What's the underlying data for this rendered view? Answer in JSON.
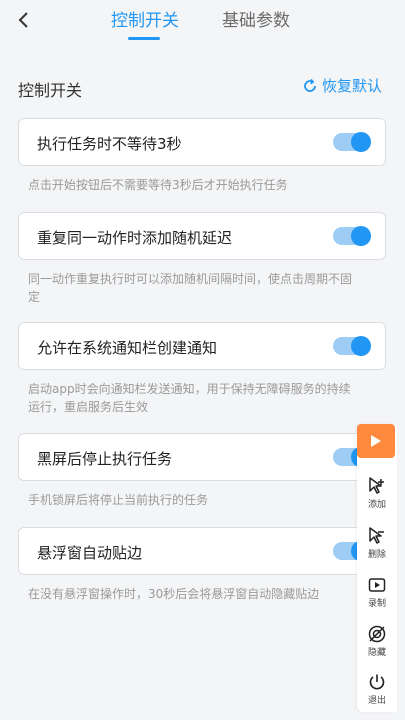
{
  "header": {
    "tabs": [
      {
        "label": "控制开关",
        "active": true
      },
      {
        "label": "基础参数",
        "active": false
      }
    ]
  },
  "section": {
    "title": "控制开关",
    "reset_label": "恢复默认"
  },
  "settings": [
    {
      "label": "执行任务时不等待3秒",
      "enabled": true,
      "desc": "点击开始按钮后不需要等待3秒后才开始执行任务"
    },
    {
      "label": "重复同一动作时添加随机延迟",
      "enabled": true,
      "desc": "同一动作重复执行时可以添加随机间隔时间，使点击周期不固定"
    },
    {
      "label": "允许在系统通知栏创建通知",
      "enabled": true,
      "desc": "启动app时会向通知栏发送通知，用于保持无障碍服务的持续运行，重启服务后生效"
    },
    {
      "label": "黑屏后停止执行任务",
      "enabled": true,
      "desc": "手机锁屏后将停止当前执行的任务"
    },
    {
      "label": "悬浮窗自动贴边",
      "enabled": true,
      "desc": "在没有悬浮窗操作时，30秒后会将悬浮窗自动隐藏贴边"
    }
  ],
  "floating_toolbar": {
    "tools": [
      {
        "label": "添加",
        "icon": "add-pointer-icon"
      },
      {
        "label": "删除",
        "icon": "remove-pointer-icon"
      },
      {
        "label": "录制",
        "icon": "record-icon"
      },
      {
        "label": "隐藏",
        "icon": "hide-icon"
      },
      {
        "label": "退出",
        "icon": "power-icon"
      }
    ]
  },
  "colors": {
    "accent": "#2196f3",
    "toggle_track": "#9dccf4",
    "play_button": "#ff8a3d",
    "background": "#f4f5f7"
  }
}
